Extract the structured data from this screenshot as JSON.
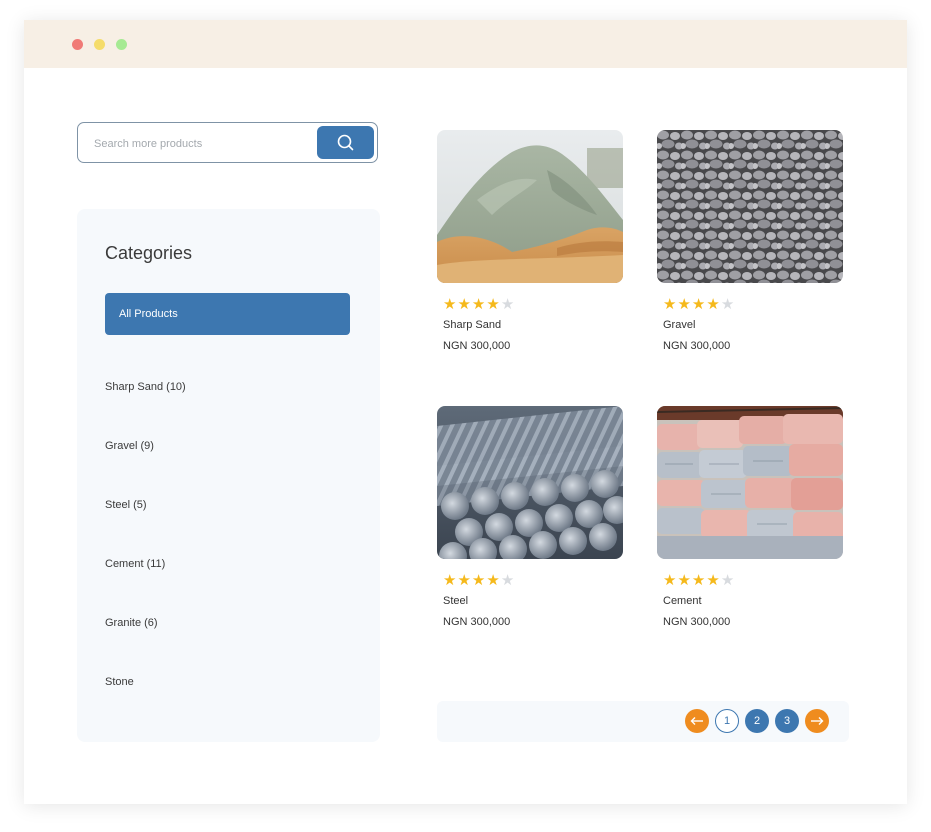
{
  "search": {
    "placeholder": "Search more products"
  },
  "categories": {
    "title": "Categories",
    "all_label": "All Products",
    "items": [
      {
        "label": "Sharp Sand (10)"
      },
      {
        "label": "Gravel (9)"
      },
      {
        "label": "Steel (5)"
      },
      {
        "label": "Cement (11)"
      },
      {
        "label": "Granite (6)"
      },
      {
        "label": "Stone"
      }
    ]
  },
  "products": [
    {
      "name": "Sharp Sand",
      "price": "NGN 300,000",
      "rating": 4,
      "max_rating": 5
    },
    {
      "name": "Gravel",
      "price": "NGN 300,000",
      "rating": 4,
      "max_rating": 5
    },
    {
      "name": "Steel",
      "price": "NGN 300,000",
      "rating": 4,
      "max_rating": 5
    },
    {
      "name": "Cement",
      "price": "NGN 300,000",
      "rating": 4,
      "max_rating": 5
    }
  ],
  "pagination": {
    "pages": [
      "1",
      "2",
      "3"
    ],
    "current": "1"
  },
  "colors": {
    "accent": "#3d77b0",
    "arrow": "#ef8c1f",
    "star": "#f5b91c",
    "titlebar": "#f7efe5"
  },
  "icons": {
    "search": "search-icon",
    "prev": "arrow-left-icon",
    "next": "arrow-right-icon",
    "star": "star-icon"
  }
}
